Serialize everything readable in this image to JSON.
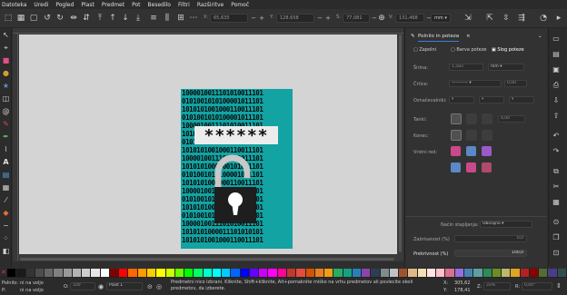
{
  "menu": [
    "Datoteka",
    "Uredi",
    "Pogled",
    "Plast",
    "Predmet",
    "Pot",
    "Besedilo",
    "Filtri",
    "Razširitve",
    "Pomoč"
  ],
  "controls": {
    "x_label": "X:",
    "x_value": "65,635",
    "y_label": "Y:",
    "y_value": "128,658",
    "w_label": "Š:",
    "w_value": "77,081",
    "h_label": "V:",
    "h_value": "131,468",
    "unit": "mm"
  },
  "artwork": {
    "binary_rows": [
      "1000010011101010011101",
      "0101001010100001011101",
      "1010101001000110011101",
      "0101001010100001011101",
      "1000010011101010011101",
      "1010101000011101010101",
      "0101001010100001011101",
      "1010101001000110011101",
      "1000010011101010011101",
      "1010101000000101001101",
      "0101001010100001011101",
      "1010101001000110011101",
      "1000010011101010011101",
      "0101001010100001011101",
      "1010101001000110011101",
      "0101001010100001011101",
      "1000010011101010011101",
      "1010101000011101010101",
      "1010101001000110011101"
    ],
    "password_mask": "******",
    "teal": "#13a3a3",
    "lock_body": "#1e1e1e",
    "lock_shackle": "#c8c8c8"
  },
  "dock": {
    "panel_title": "Polnilo in poteza",
    "subtabs": [
      "Zapolni",
      "Barva poteze",
      "Slog poteze"
    ],
    "stroke": {
      "width_label": "Širina:",
      "width_value": "1,583",
      "width_unit": "mm",
      "dashes_label": "Črtice:",
      "dashes_value": "0,00",
      "markers_label": "Označevalniki:",
      "join_label": "Tanki:",
      "miter_value": "4,00",
      "cap_label": "Konec:",
      "order_label": "Vrstni red:"
    },
    "footer": {
      "blend_label": "Način stapljanja:",
      "blend_value": "Običajno",
      "blur_label": "Zabrisanost (%)",
      "blur_value": "0,0",
      "opacity_label": "Prekrivnost (%)",
      "opacity_value": "100,0"
    },
    "accent": "#3d7fd9"
  },
  "palette": [
    "#000000",
    "#1a1a1a",
    "#333333",
    "#4d4d4d",
    "#666666",
    "#808080",
    "#999999",
    "#b3b3b3",
    "#cccccc",
    "#e6e6e6",
    "#ffffff",
    "#800000",
    "#ff0000",
    "#ff6600",
    "#ff9900",
    "#ffcc00",
    "#ffff00",
    "#ccff00",
    "#66ff00",
    "#00ff00",
    "#00ff66",
    "#00ffcc",
    "#00ffff",
    "#00ccff",
    "#0066ff",
    "#0000ff",
    "#6600ff",
    "#cc00ff",
    "#ff00ff",
    "#ff0099",
    "#c0392b",
    "#e74c3c",
    "#d35400",
    "#e67e22",
    "#f39c12",
    "#27ae60",
    "#16a085",
    "#2980b9",
    "#8e44ad",
    "#2c3e50",
    "#7f8c8d",
    "#bdc3c7",
    "#a0522d",
    "#deb887",
    "#f5deb3",
    "#ffe4e1",
    "#ffc0cb",
    "#db7093",
    "#9370db",
    "#4682b4",
    "#5f9ea0",
    "#2e8b57",
    "#6b8e23",
    "#bdb76b",
    "#daa520",
    "#b22222",
    "#8b0000",
    "#556b2f",
    "#483d8b",
    "#2f4f4f"
  ],
  "status": {
    "fill_label": "Polnilo:",
    "fill_value": "ni na voljo",
    "stroke_label": "P:",
    "stroke_value": "ni na voljo",
    "opacity_label": "O:",
    "opacity_value": "100",
    "layer": "Plast 1",
    "message": "Predmetni nico izbrani. Kliknite, Shift+kliknite, Alt+pomaknite miško na vrhu predmetov ali povlecite okoli predmetov, da izberete.",
    "cursor_x": "305,62",
    "cursor_y": "178,41",
    "zoom_label": "Z:",
    "zoom_value": "33%",
    "rot_label": "R:",
    "rot_value": "0,00°"
  }
}
